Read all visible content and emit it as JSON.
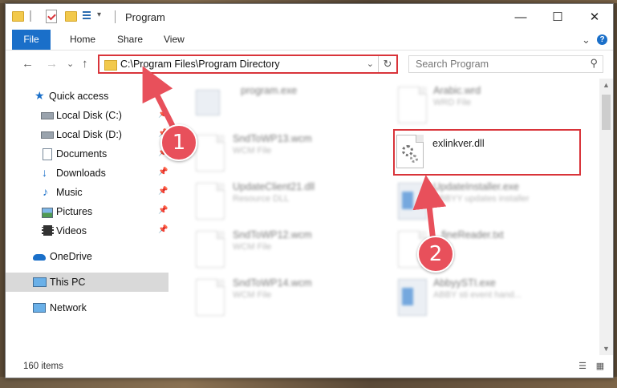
{
  "window": {
    "title": "Program",
    "minimize_glyph": "—",
    "maximize_glyph": "☐",
    "close_glyph": "✕"
  },
  "ribbon": {
    "tabs": [
      "File",
      "Home",
      "Share",
      "View"
    ],
    "expand_glyph": "⌄",
    "help_glyph": "?"
  },
  "address": {
    "back_glyph": "←",
    "forward_glyph": "→",
    "recent_glyph": "⌄",
    "up_glyph": "↑",
    "path": "C:\\Program Files\\Program Directory",
    "dropdown_glyph": "⌄",
    "refresh_glyph": "↻"
  },
  "search": {
    "placeholder": "Search Program",
    "icon_glyph": "⚲"
  },
  "nav": {
    "items": [
      {
        "label": "Quick access",
        "icon": "star-icon",
        "pin": ""
      },
      {
        "label": "Local Disk (C:)",
        "icon": "drive-icon",
        "pin": "📌"
      },
      {
        "label": "Local Disk (D:)",
        "icon": "drive-icon",
        "pin": "📌"
      },
      {
        "label": "Documents",
        "icon": "documents-icon",
        "pin": "📌"
      },
      {
        "label": "Downloads",
        "icon": "download-icon",
        "pin": "📌"
      },
      {
        "label": "Music",
        "icon": "music-icon",
        "pin": "📌"
      },
      {
        "label": "Pictures",
        "icon": "pictures-icon",
        "pin": "📌"
      },
      {
        "label": "Videos",
        "icon": "videos-icon",
        "pin": "📌"
      },
      {
        "label": "OneDrive",
        "icon": "cloud-icon",
        "pin": ""
      },
      {
        "label": "This PC",
        "icon": "computer-icon",
        "pin": ""
      },
      {
        "label": "Network",
        "icon": "network-icon",
        "pin": ""
      }
    ]
  },
  "files": [
    {
      "name": "program.exe",
      "type": ""
    },
    {
      "name": "Arabic.wrd",
      "type": "WRD File"
    },
    {
      "name": "SndToWP13.wcm",
      "type": "WCM File"
    },
    {
      "name": "exlinkver.dll",
      "type": ""
    },
    {
      "name": "UpdateClient21.dll",
      "type": "Resource DLL"
    },
    {
      "name": "UpdateInstaller.exe",
      "type": "ABBYY updates installer"
    },
    {
      "name": "SndToWP12.wcm",
      "type": "WCM File"
    },
    {
      "name": "...fineReader.txt",
      "type": "...file"
    },
    {
      "name": "SndToWP14.wcm",
      "type": "WCM File"
    },
    {
      "name": "AbbyySTI.exe",
      "type": "ABBY sti event hand..."
    }
  ],
  "status": {
    "count": "160 items"
  },
  "annotations": {
    "step1": "1",
    "step2": "2"
  },
  "colors": {
    "accent": "#1a6fc9",
    "highlight": "#d9343a",
    "badge": "#e8505b"
  }
}
